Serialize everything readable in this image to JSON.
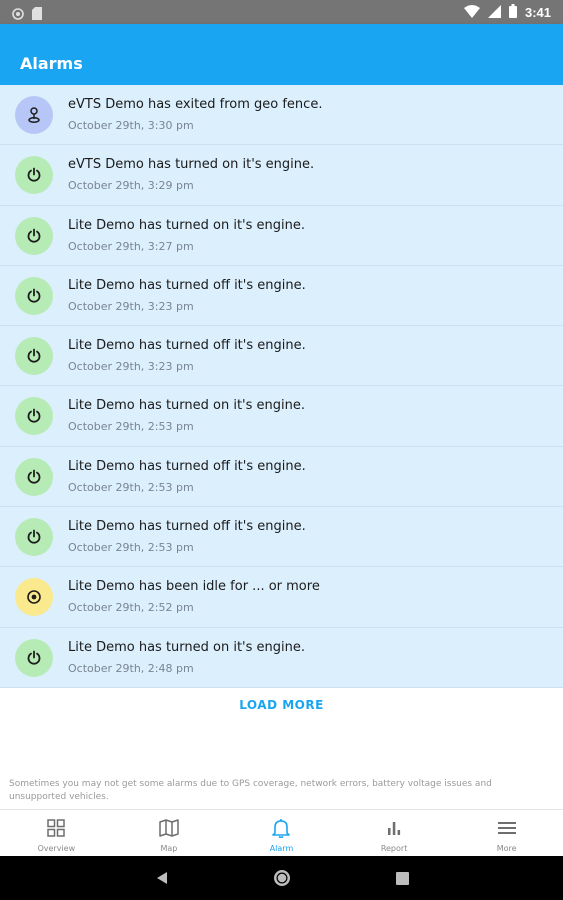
{
  "status_bar": {
    "time": "3:41"
  },
  "app_bar": {
    "title": "Alarms"
  },
  "alarms": [
    {
      "type": "geofence",
      "icon": "geofence-icon",
      "title": "eVTS Demo has exited from geo fence.",
      "time": "October 29th, 3:30 pm"
    },
    {
      "type": "power",
      "icon": "power-icon",
      "title": "eVTS Demo has turned on it's engine.",
      "time": "October 29th, 3:29 pm"
    },
    {
      "type": "power",
      "icon": "power-icon",
      "title": "Lite Demo has turned on it's engine.",
      "time": "October 29th, 3:27 pm"
    },
    {
      "type": "power",
      "icon": "power-icon",
      "title": "Lite Demo has turned off it's engine.",
      "time": "October 29th, 3:23 pm"
    },
    {
      "type": "power",
      "icon": "power-icon",
      "title": "Lite Demo has turned off it's engine.",
      "time": "October 29th, 3:23 pm"
    },
    {
      "type": "power",
      "icon": "power-icon",
      "title": "Lite Demo has turned on it's engine.",
      "time": "October 29th, 2:53 pm"
    },
    {
      "type": "power",
      "icon": "power-icon",
      "title": "Lite Demo has turned off it's engine.",
      "time": "October 29th, 2:53 pm"
    },
    {
      "type": "power",
      "icon": "power-icon",
      "title": "Lite Demo has turned off it's engine.",
      "time": "October 29th, 2:53 pm"
    },
    {
      "type": "idle",
      "icon": "idle-icon",
      "title": "Lite Demo has been idle for ... or more",
      "time": "October 29th, 2:52 pm"
    },
    {
      "type": "power",
      "icon": "power-icon",
      "title": "Lite Demo has turned on it's engine.",
      "time": "October 29th, 2:48 pm"
    }
  ],
  "load_more_label": "LOAD MORE",
  "disclaimer": "Sometimes you may not get some alarms due to GPS coverage, network errors, battery voltage issues and unsupported vehicles.",
  "bottom_nav": [
    {
      "label": "Overview",
      "icon": "overview-icon",
      "active": false
    },
    {
      "label": "Map",
      "icon": "map-icon",
      "active": false
    },
    {
      "label": "Alarm",
      "icon": "bell-icon",
      "active": true
    },
    {
      "label": "Report",
      "icon": "bar-chart-icon",
      "active": false
    },
    {
      "label": "More",
      "icon": "menu-icon",
      "active": false
    }
  ],
  "colors": {
    "accent": "#1aa5f2",
    "list_background": "#dbeffd",
    "power_avatar": "#b7ebb5",
    "geofence_avatar": "#b6c7f7",
    "idle_avatar": "#fbe98d"
  }
}
